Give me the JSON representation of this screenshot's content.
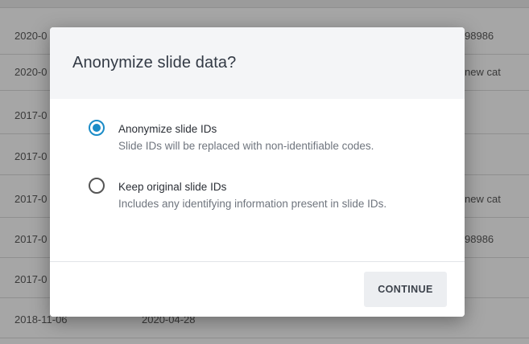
{
  "background_table": {
    "rows": [
      {
        "col1": "2020-0",
        "col2": "",
        "col3": "98986"
      },
      {
        "col1": "2020-0",
        "col2": "",
        "col3": "new cat"
      },
      {
        "col1": "2017-0",
        "col2": "",
        "col3": ""
      },
      {
        "col1": "2017-0",
        "col2": "",
        "col3": ""
      },
      {
        "col1": "2017-0",
        "col2": "",
        "col3": "new cat"
      },
      {
        "col1": "2017-0",
        "col2": "",
        "col3": "98986"
      },
      {
        "col1": "2017-0",
        "col2": "",
        "col3": ""
      },
      {
        "col1": "2018-11-06",
        "col2": "2020-04-28",
        "col3": ""
      }
    ]
  },
  "dialog": {
    "title": "Anonymize slide data?",
    "options": [
      {
        "label": "Anonymize slide IDs",
        "description": "Slide IDs will be replaced with non-identifiable codes.",
        "selected": true
      },
      {
        "label": "Keep original slide IDs",
        "description": "Includes any identifying information present in slide IDs.",
        "selected": false
      }
    ],
    "continue_label": "CONTINUE"
  },
  "colors": {
    "accent": "#1a8bc7",
    "overlay": "#a6a6a6",
    "header_bg": "#f4f5f7"
  }
}
